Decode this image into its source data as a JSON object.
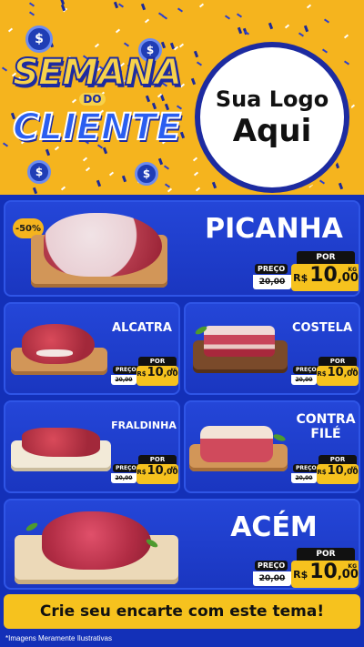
{
  "header": {
    "title_line1": "SEMANA",
    "title_do": "DO",
    "title_line2": "CLIENTE",
    "coin_symbol": "$",
    "logo_line1": "Sua Logo",
    "logo_line2": "Aqui"
  },
  "labels": {
    "por": "POR",
    "preco": "PREÇO",
    "currency": "R$",
    "unit": "KG"
  },
  "products": [
    {
      "name": "PICANHA",
      "badge": "-50%",
      "old_price": "20,00",
      "price_int": "10",
      "price_dec": ",00"
    },
    {
      "name": "ALCATRA",
      "old_price": "20,00",
      "price_int": "10",
      "price_dec": ",00"
    },
    {
      "name": "COSTELA",
      "old_price": "20,00",
      "price_int": "10",
      "price_dec": ",00"
    },
    {
      "name": "FRALDINHA",
      "old_price": "20,00",
      "price_int": "10",
      "price_dec": ",00"
    },
    {
      "name_line1": "CONTRA",
      "name_line2": "FILÉ",
      "old_price": "20,00",
      "price_int": "10",
      "price_dec": ",00"
    },
    {
      "name": "ACÉM",
      "old_price": "20,00",
      "price_int": "10",
      "price_dec": ",00"
    }
  ],
  "banner": "Crie seu encarte com este tema!",
  "footnote": "*Imagens Meramente Ilustrativas",
  "colors": {
    "brand_yellow": "#f5b41e",
    "brand_blue": "#1330b8",
    "price_yellow": "#f6c21e"
  }
}
